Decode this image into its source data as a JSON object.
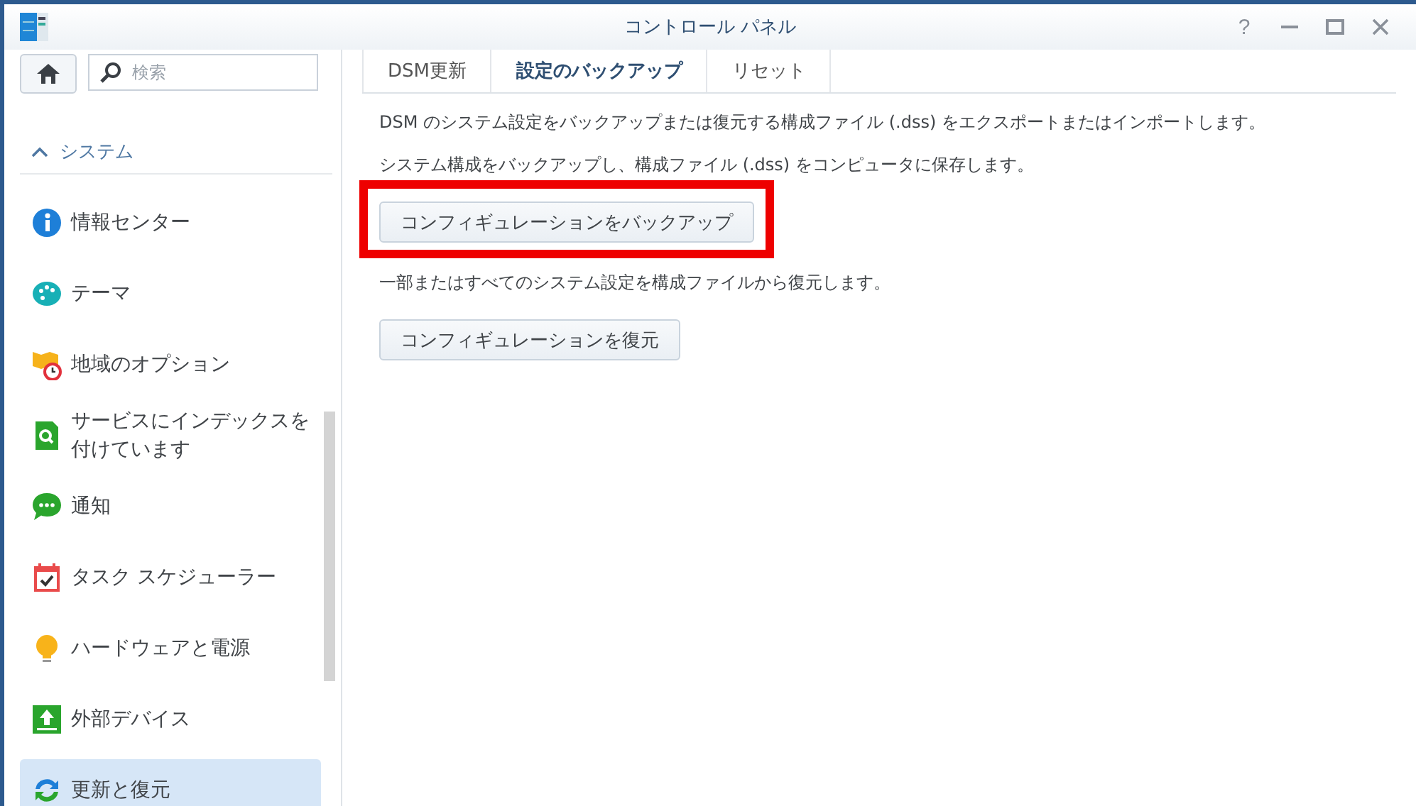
{
  "window": {
    "title": "コントロール パネル",
    "controls": [
      {
        "kind": "help",
        "label": "?"
      },
      {
        "kind": "minimize"
      },
      {
        "kind": "maximize"
      },
      {
        "kind": "close"
      }
    ]
  },
  "sidebar": {
    "search": {
      "placeholder": "検索"
    },
    "section": {
      "label": "システム",
      "expanded": true
    },
    "items": [
      {
        "kind": "info",
        "label": "情報センター",
        "selected": false
      },
      {
        "kind": "palette",
        "label": "テーマ",
        "selected": false
      },
      {
        "kind": "map",
        "label": "地域のオプション",
        "selected": false
      },
      {
        "kind": "index",
        "label": "サービスにインデックスを付けています",
        "selected": false
      },
      {
        "kind": "chat",
        "label": "通知",
        "selected": false
      },
      {
        "kind": "calendar",
        "label": "タスク スケジューラー",
        "selected": false
      },
      {
        "kind": "bulb",
        "label": "ハードウェアと電源",
        "selected": false
      },
      {
        "kind": "upload",
        "label": "外部デバイス",
        "selected": false
      },
      {
        "kind": "refresh",
        "label": "更新と復元",
        "selected": true
      }
    ]
  },
  "tabs": [
    {
      "label": "DSM更新",
      "selected": false
    },
    {
      "label": "設定のバックアップ",
      "selected": true
    },
    {
      "label": "リセット",
      "selected": false
    }
  ],
  "content": [
    {
      "kind": "text",
      "text": "DSM のシステム設定をバックアップまたは復元する構成ファイル (.dss) をエクスポートまたはインポートします。"
    },
    {
      "kind": "text",
      "text": "システム構成をバックアップし、構成ファイル (.dss) をコンピュータに保存します。"
    },
    {
      "kind": "button",
      "text": "コンフィギュレーションをバックアップ",
      "highlighted": true
    },
    {
      "kind": "text",
      "text": "一部またはすべてのシステム設定を構成ファイルから復元します。"
    },
    {
      "kind": "button",
      "text": "コンフィギュレーションを復元",
      "highlighted": false
    }
  ]
}
